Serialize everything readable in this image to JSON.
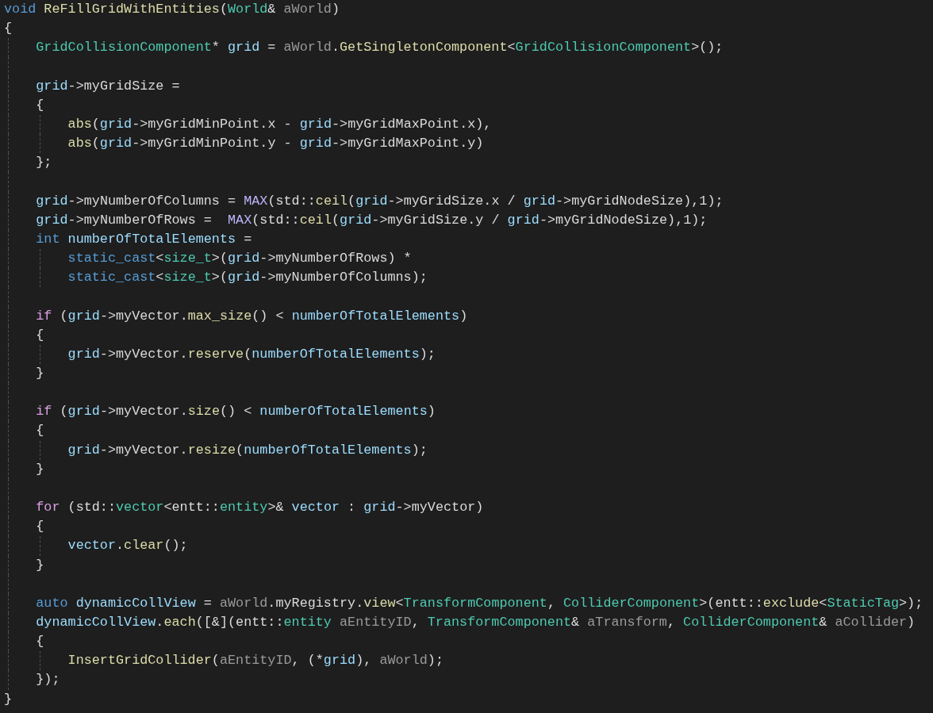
{
  "lines": [
    {
      "tokens": [
        {
          "kind": "keyword",
          "text": "void "
        },
        {
          "kind": "function",
          "text": "ReFillGridWithEntities"
        },
        {
          "kind": "plain",
          "text": "("
        },
        {
          "kind": "type",
          "text": "World"
        },
        {
          "kind": "plain",
          "text": "& "
        },
        {
          "kind": "parameter",
          "text": "aWorld"
        },
        {
          "kind": "plain",
          "text": ")"
        }
      ]
    },
    {
      "tokens": [
        {
          "kind": "plain",
          "text": "{"
        }
      ],
      "children": [
        {
          "tokens": [
            {
              "kind": "type",
              "text": "GridCollisionComponent"
            },
            {
              "kind": "plain",
              "text": "* "
            },
            {
              "kind": "local",
              "text": "grid"
            },
            {
              "kind": "plain",
              "text": " = "
            },
            {
              "kind": "parameter",
              "text": "aWorld"
            },
            {
              "kind": "plain",
              "text": "."
            },
            {
              "kind": "function",
              "text": "GetSingletonComponent"
            },
            {
              "kind": "plain",
              "text": "<"
            },
            {
              "kind": "type",
              "text": "GridCollisionComponent"
            },
            {
              "kind": "plain",
              "text": ">();"
            }
          ]
        },
        {
          "gap_before": true,
          "tokens": [
            {
              "kind": "local",
              "text": "grid"
            },
            {
              "kind": "plain",
              "text": "->"
            },
            {
              "kind": "member",
              "text": "myGridSize"
            },
            {
              "kind": "plain",
              "text": " ="
            }
          ]
        },
        {
          "tokens": [
            {
              "kind": "plain",
              "text": "{"
            }
          ],
          "children": [
            {
              "tokens": [
                {
                  "kind": "function",
                  "text": "abs"
                },
                {
                  "kind": "plain",
                  "text": "("
                },
                {
                  "kind": "local",
                  "text": "grid"
                },
                {
                  "kind": "plain",
                  "text": "->"
                },
                {
                  "kind": "member",
                  "text": "myGridMinPoint"
                },
                {
                  "kind": "plain",
                  "text": "."
                },
                {
                  "kind": "member",
                  "text": "x"
                },
                {
                  "kind": "plain",
                  "text": " - "
                },
                {
                  "kind": "local",
                  "text": "grid"
                },
                {
                  "kind": "plain",
                  "text": "->"
                },
                {
                  "kind": "member",
                  "text": "myGridMaxPoint"
                },
                {
                  "kind": "plain",
                  "text": "."
                },
                {
                  "kind": "member",
                  "text": "x"
                },
                {
                  "kind": "plain",
                  "text": "),"
                }
              ]
            },
            {
              "tokens": [
                {
                  "kind": "function",
                  "text": "abs"
                },
                {
                  "kind": "plain",
                  "text": "("
                },
                {
                  "kind": "local",
                  "text": "grid"
                },
                {
                  "kind": "plain",
                  "text": "->"
                },
                {
                  "kind": "member",
                  "text": "myGridMinPoint"
                },
                {
                  "kind": "plain",
                  "text": "."
                },
                {
                  "kind": "member",
                  "text": "y"
                },
                {
                  "kind": "plain",
                  "text": " - "
                },
                {
                  "kind": "local",
                  "text": "grid"
                },
                {
                  "kind": "plain",
                  "text": "->"
                },
                {
                  "kind": "member",
                  "text": "myGridMaxPoint"
                },
                {
                  "kind": "plain",
                  "text": "."
                },
                {
                  "kind": "member",
                  "text": "y"
                },
                {
                  "kind": "plain",
                  "text": ")"
                }
              ]
            }
          ]
        },
        {
          "tokens": [
            {
              "kind": "plain",
              "text": "};"
            }
          ]
        },
        {
          "gap_before": true,
          "tokens": [
            {
              "kind": "local",
              "text": "grid"
            },
            {
              "kind": "plain",
              "text": "->"
            },
            {
              "kind": "member",
              "text": "myNumberOfColumns"
            },
            {
              "kind": "plain",
              "text": " = "
            },
            {
              "kind": "macro",
              "text": "MAX"
            },
            {
              "kind": "plain",
              "text": "(std::"
            },
            {
              "kind": "function",
              "text": "ceil"
            },
            {
              "kind": "plain",
              "text": "("
            },
            {
              "kind": "local",
              "text": "grid"
            },
            {
              "kind": "plain",
              "text": "->"
            },
            {
              "kind": "member",
              "text": "myGridSize"
            },
            {
              "kind": "plain",
              "text": "."
            },
            {
              "kind": "member",
              "text": "x"
            },
            {
              "kind": "plain",
              "text": " / "
            },
            {
              "kind": "local",
              "text": "grid"
            },
            {
              "kind": "plain",
              "text": "->"
            },
            {
              "kind": "member",
              "text": "myGridNodeSize"
            },
            {
              "kind": "plain",
              "text": "),1);"
            }
          ]
        },
        {
          "tokens": [
            {
              "kind": "local",
              "text": "grid"
            },
            {
              "kind": "plain",
              "text": "->"
            },
            {
              "kind": "member",
              "text": "myNumberOfRows"
            },
            {
              "kind": "plain",
              "text": " =  "
            },
            {
              "kind": "macro",
              "text": "MAX"
            },
            {
              "kind": "plain",
              "text": "(std::"
            },
            {
              "kind": "function",
              "text": "ceil"
            },
            {
              "kind": "plain",
              "text": "("
            },
            {
              "kind": "local",
              "text": "grid"
            },
            {
              "kind": "plain",
              "text": "->"
            },
            {
              "kind": "member",
              "text": "myGridSize"
            },
            {
              "kind": "plain",
              "text": "."
            },
            {
              "kind": "member",
              "text": "y"
            },
            {
              "kind": "plain",
              "text": " / "
            },
            {
              "kind": "local",
              "text": "grid"
            },
            {
              "kind": "plain",
              "text": "->"
            },
            {
              "kind": "member",
              "text": "myGridNodeSize"
            },
            {
              "kind": "plain",
              "text": "),1);"
            }
          ]
        },
        {
          "tokens": [
            {
              "kind": "keyword",
              "text": "int "
            },
            {
              "kind": "local",
              "text": "numberOfTotalElements"
            },
            {
              "kind": "plain",
              "text": " ="
            }
          ],
          "children": [
            {
              "tokens": [
                {
                  "kind": "keyword",
                  "text": "static_cast"
                },
                {
                  "kind": "plain",
                  "text": "<"
                },
                {
                  "kind": "type",
                  "text": "size_t"
                },
                {
                  "kind": "plain",
                  "text": ">("
                },
                {
                  "kind": "local",
                  "text": "grid"
                },
                {
                  "kind": "plain",
                  "text": "->"
                },
                {
                  "kind": "member",
                  "text": "myNumberOfRows"
                },
                {
                  "kind": "plain",
                  "text": ") *"
                }
              ]
            },
            {
              "tokens": [
                {
                  "kind": "keyword",
                  "text": "static_cast"
                },
                {
                  "kind": "plain",
                  "text": "<"
                },
                {
                  "kind": "type",
                  "text": "size_t"
                },
                {
                  "kind": "plain",
                  "text": ">("
                },
                {
                  "kind": "local",
                  "text": "grid"
                },
                {
                  "kind": "plain",
                  "text": "->"
                },
                {
                  "kind": "member",
                  "text": "myNumberOfColumns"
                },
                {
                  "kind": "plain",
                  "text": ");"
                }
              ]
            }
          ]
        },
        {
          "gap_before": true,
          "tokens": [
            {
              "kind": "control",
              "text": "if"
            },
            {
              "kind": "plain",
              "text": " ("
            },
            {
              "kind": "local",
              "text": "grid"
            },
            {
              "kind": "plain",
              "text": "->"
            },
            {
              "kind": "member",
              "text": "myVector"
            },
            {
              "kind": "plain",
              "text": "."
            },
            {
              "kind": "function",
              "text": "max_size"
            },
            {
              "kind": "plain",
              "text": "() < "
            },
            {
              "kind": "local",
              "text": "numberOfTotalElements"
            },
            {
              "kind": "plain",
              "text": ")"
            }
          ]
        },
        {
          "tokens": [
            {
              "kind": "plain",
              "text": "{"
            }
          ],
          "children": [
            {
              "tokens": [
                {
                  "kind": "local",
                  "text": "grid"
                },
                {
                  "kind": "plain",
                  "text": "->"
                },
                {
                  "kind": "member",
                  "text": "myVector"
                },
                {
                  "kind": "plain",
                  "text": "."
                },
                {
                  "kind": "function",
                  "text": "reserve"
                },
                {
                  "kind": "plain",
                  "text": "("
                },
                {
                  "kind": "local",
                  "text": "numberOfTotalElements"
                },
                {
                  "kind": "plain",
                  "text": ");"
                }
              ]
            }
          ]
        },
        {
          "tokens": [
            {
              "kind": "plain",
              "text": "}"
            }
          ]
        },
        {
          "gap_before": true,
          "tokens": [
            {
              "kind": "control",
              "text": "if"
            },
            {
              "kind": "plain",
              "text": " ("
            },
            {
              "kind": "local",
              "text": "grid"
            },
            {
              "kind": "plain",
              "text": "->"
            },
            {
              "kind": "member",
              "text": "myVector"
            },
            {
              "kind": "plain",
              "text": "."
            },
            {
              "kind": "function",
              "text": "size"
            },
            {
              "kind": "plain",
              "text": "() < "
            },
            {
              "kind": "local",
              "text": "numberOfTotalElements"
            },
            {
              "kind": "plain",
              "text": ")"
            }
          ]
        },
        {
          "tokens": [
            {
              "kind": "plain",
              "text": "{"
            }
          ],
          "children": [
            {
              "tokens": [
                {
                  "kind": "local",
                  "text": "grid"
                },
                {
                  "kind": "plain",
                  "text": "->"
                },
                {
                  "kind": "member",
                  "text": "myVector"
                },
                {
                  "kind": "plain",
                  "text": "."
                },
                {
                  "kind": "function",
                  "text": "resize"
                },
                {
                  "kind": "plain",
                  "text": "("
                },
                {
                  "kind": "local",
                  "text": "numberOfTotalElements"
                },
                {
                  "kind": "plain",
                  "text": ");"
                }
              ]
            }
          ]
        },
        {
          "tokens": [
            {
              "kind": "plain",
              "text": "}"
            }
          ]
        },
        {
          "gap_before": true,
          "tokens": [
            {
              "kind": "control",
              "text": "for"
            },
            {
              "kind": "plain",
              "text": " (std::"
            },
            {
              "kind": "type",
              "text": "vector"
            },
            {
              "kind": "plain",
              "text": "<entt::"
            },
            {
              "kind": "type",
              "text": "entity"
            },
            {
              "kind": "plain",
              "text": ">& "
            },
            {
              "kind": "local",
              "text": "vector"
            },
            {
              "kind": "plain",
              "text": " : "
            },
            {
              "kind": "local",
              "text": "grid"
            },
            {
              "kind": "plain",
              "text": "->"
            },
            {
              "kind": "member",
              "text": "myVector"
            },
            {
              "kind": "plain",
              "text": ")"
            }
          ]
        },
        {
          "tokens": [
            {
              "kind": "plain",
              "text": "{"
            }
          ],
          "children": [
            {
              "tokens": [
                {
                  "kind": "local",
                  "text": "vector"
                },
                {
                  "kind": "plain",
                  "text": "."
                },
                {
                  "kind": "function",
                  "text": "clear"
                },
                {
                  "kind": "plain",
                  "text": "();"
                }
              ]
            }
          ]
        },
        {
          "tokens": [
            {
              "kind": "plain",
              "text": "}"
            }
          ]
        },
        {
          "gap_before": true,
          "tokens": [
            {
              "kind": "keyword",
              "text": "auto "
            },
            {
              "kind": "local",
              "text": "dynamicCollView"
            },
            {
              "kind": "plain",
              "text": " = "
            },
            {
              "kind": "parameter",
              "text": "aWorld"
            },
            {
              "kind": "plain",
              "text": "."
            },
            {
              "kind": "member",
              "text": "myRegistry"
            },
            {
              "kind": "plain",
              "text": "."
            },
            {
              "kind": "function",
              "text": "view"
            },
            {
              "kind": "plain",
              "text": "<"
            },
            {
              "kind": "type",
              "text": "TransformComponent"
            },
            {
              "kind": "plain",
              "text": ", "
            },
            {
              "kind": "type",
              "text": "ColliderComponent"
            },
            {
              "kind": "plain",
              "text": ">(entt::"
            },
            {
              "kind": "function",
              "text": "exclude"
            },
            {
              "kind": "plain",
              "text": "<"
            },
            {
              "kind": "type",
              "text": "StaticTag"
            },
            {
              "kind": "plain",
              "text": ">);"
            }
          ]
        },
        {
          "tokens": [
            {
              "kind": "local",
              "text": "dynamicCollView"
            },
            {
              "kind": "plain",
              "text": "."
            },
            {
              "kind": "function",
              "text": "each"
            },
            {
              "kind": "plain",
              "text": "([&](entt::"
            },
            {
              "kind": "type",
              "text": "entity "
            },
            {
              "kind": "parameter",
              "text": "aEntityID"
            },
            {
              "kind": "plain",
              "text": ", "
            },
            {
              "kind": "type",
              "text": "TransformComponent"
            },
            {
              "kind": "plain",
              "text": "& "
            },
            {
              "kind": "parameter",
              "text": "aTransform"
            },
            {
              "kind": "plain",
              "text": ", "
            },
            {
              "kind": "type",
              "text": "ColliderComponent"
            },
            {
              "kind": "plain",
              "text": "& "
            },
            {
              "kind": "parameter",
              "text": "aCollider"
            },
            {
              "kind": "plain",
              "text": ")"
            }
          ]
        },
        {
          "tokens": [
            {
              "kind": "plain",
              "text": "{"
            }
          ],
          "children": [
            {
              "tokens": [
                {
                  "kind": "function",
                  "text": "InsertGridCollider"
                },
                {
                  "kind": "plain",
                  "text": "("
                },
                {
                  "kind": "parameter",
                  "text": "aEntityID"
                },
                {
                  "kind": "plain",
                  "text": ", (*"
                },
                {
                  "kind": "local",
                  "text": "grid"
                },
                {
                  "kind": "plain",
                  "text": "), "
                },
                {
                  "kind": "parameter",
                  "text": "aWorld"
                },
                {
                  "kind": "plain",
                  "text": ");"
                }
              ]
            }
          ]
        },
        {
          "tokens": [
            {
              "kind": "plain",
              "text": "});"
            }
          ]
        }
      ]
    },
    {
      "tokens": [
        {
          "kind": "plain",
          "text": "}"
        }
      ]
    }
  ]
}
